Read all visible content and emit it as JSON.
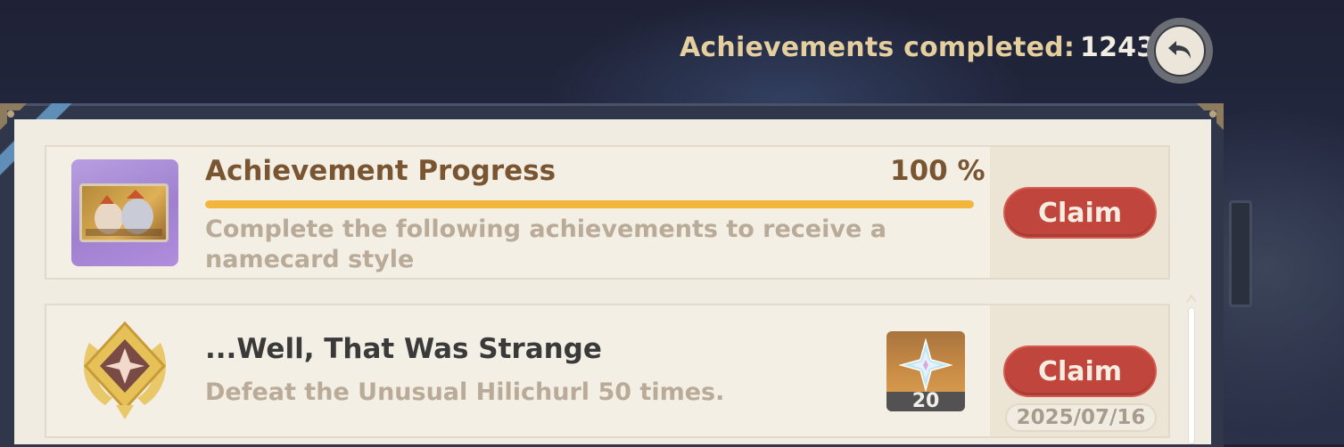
{
  "header": {
    "count_label": "Achievements completed:",
    "count_value": "1243",
    "back_icon": "back-arrow-icon"
  },
  "progress_card": {
    "title": "Achievement Progress",
    "percent_text": "100 %",
    "progress_fraction": 1.0,
    "description": "Complete the following achievements to receive a namecard style",
    "icon": "namecard-icon",
    "claim_label": "Claim"
  },
  "achievement": {
    "title": "...Well, That Was Strange",
    "description": "Defeat the Unusual Hilichurl 50 times.",
    "icon": "achievement-badge-icon",
    "reward_icon": "primogem-icon",
    "reward_quantity": "20",
    "claim_label": "Claim",
    "date": "2025/07/16"
  },
  "colors": {
    "accent_gold": "#e6cf9f",
    "claim_red": "#c0463d",
    "progress_yellow": "#f3b63c",
    "title_brown": "#7a5532"
  }
}
